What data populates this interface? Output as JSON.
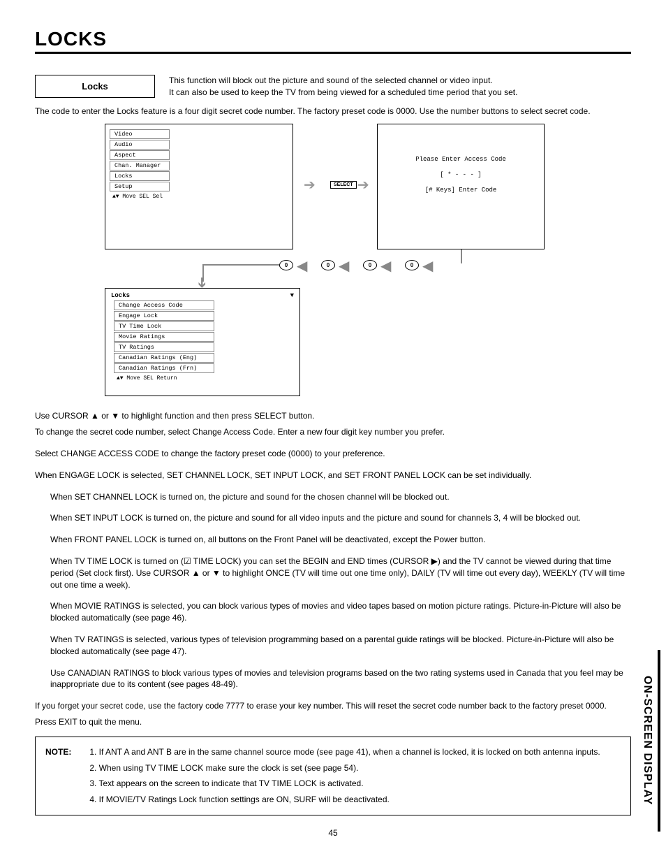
{
  "page": {
    "title": "LOCKS",
    "side_tab": "ON-SCREEN DISPLAY",
    "number": "45"
  },
  "section_label": "Locks",
  "intro": {
    "line1": "This function will block out the picture and sound of the selected channel or video input.",
    "line2": "It can also be used to keep the TV from being viewed for a scheduled time period that you set."
  },
  "pre_diagram": "The code to enter the Locks feature is a four digit secret code number.  The factory preset code is 0000. Use the number buttons to select secret code.",
  "main_menu": {
    "items": [
      "Video",
      "Audio",
      "Aspect",
      "Chan. Manager",
      "Locks",
      "Setup"
    ],
    "footer": "▲▼ Move  SEL Sel"
  },
  "select_label": "SELECT",
  "access_screen": {
    "line1": "Please Enter Access Code",
    "line2": "[ * - - - ]",
    "line3": "[# Keys] Enter Code"
  },
  "zero": "0",
  "locks_menu": {
    "title": "Locks",
    "items": [
      "Change Access Code",
      "Engage Lock",
      "TV Time Lock",
      "Movie Ratings",
      "TV Ratings",
      "Canadian Ratings (Eng)",
      "Canadian Ratings (Frn)"
    ],
    "footer": "▲▼ Move  SEL Return"
  },
  "body": {
    "p1": "Use CURSOR ▲ or ▼ to highlight function and then press SELECT button.",
    "p2": "To change the secret code number, select Change Access Code.  Enter a new four digit key number you prefer.",
    "p3": "Select CHANGE ACCESS CODE to change the factory preset code (0000) to your preference.",
    "p4": "When ENGAGE LOCK is selected, SET CHANNEL LOCK, SET INPUT LOCK, and SET FRONT PANEL LOCK can be set individually.",
    "p5": "When SET CHANNEL LOCK is turned on, the picture and sound for the chosen channel will be blocked out.",
    "p6": "When SET INPUT LOCK is turned on, the picture and sound for all video inputs and the picture and sound for channels 3, 4 will be blocked out.",
    "p7": "When FRONT PANEL LOCK is turned on, all buttons on the Front Panel will be deactivated, except the Power button.",
    "p8": "When TV TIME LOCK is turned on (☑ TIME LOCK) you can set the BEGIN and END times (CURSOR ▶) and the TV cannot be viewed during that time period (Set clock first). Use CURSOR ▲ or ▼ to highlight ONCE (TV will time out one time only), DAILY (TV will time out every day), WEEKLY (TV will time out one time a week).",
    "p9": "When MOVIE RATINGS is selected, you can block various types of movies and video tapes based on motion picture ratings.  Picture-in-Picture will also be blocked automatically (see page 46).",
    "p10": "When TV RATINGS is selected, various types of television programming based on a parental guide ratings will be blocked. Picture-in-Picture will also be blocked automatically (see page 47).",
    "p11": "Use CANADIAN RATINGS to block various types of movies and television programs based on the two rating systems used in Canada that you feel may be inappropriate due to its content (see pages 48-49).",
    "p12": "If you forget your secret code, use the factory code 7777 to erase your key number. This will reset the secret code number back to the factory preset 0000.",
    "p13": "Press EXIT to quit the menu."
  },
  "note": {
    "label": "NOTE:",
    "items": [
      "1. If ANT A and ANT B are in the same channel source mode (see page 41), when a channel is locked, it is locked on both antenna inputs.",
      "2. When using TV TIME LOCK make sure the clock is set (see page 54).",
      "3. Text appears on the screen to indicate that TV TIME LOCK is activated.",
      "4. If MOVIE/TV Ratings Lock function settings are ON, SURF will be deactivated."
    ]
  }
}
